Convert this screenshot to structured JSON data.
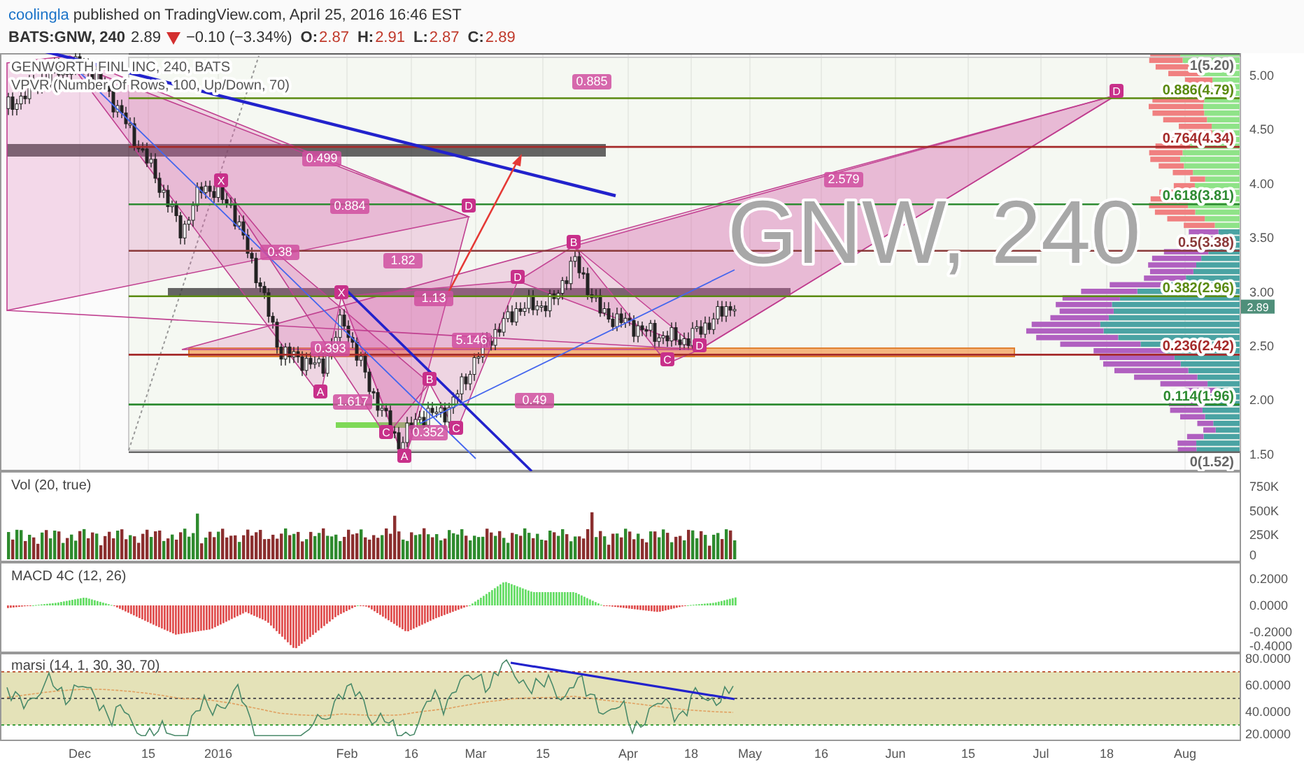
{
  "header": {
    "author": "coolingla",
    "published": "published on TradingView.com, April 25, 2016 16:46 EST"
  },
  "quote": {
    "symbol": "BATS:GNW, 240",
    "last": "2.89",
    "falling": true,
    "change": "−0.10 (−3.34%)",
    "ohlc": [
      {
        "label": "O:",
        "value": "2.87"
      },
      {
        "label": "H:",
        "value": "2.91"
      },
      {
        "label": "L:",
        "value": "2.87"
      },
      {
        "label": "C:",
        "value": "2.89"
      }
    ]
  },
  "main_pane": {
    "legend": [
      "GENWORTH FINL INC, 240, BATS",
      "VPVR (Number Of Rows, 100, Up/Down, 70)"
    ],
    "watermark": "GNW, 240",
    "ratio_labels": [
      "0.885",
      "0.499",
      "2.579",
      "0.884",
      "0.38",
      "1.82",
      "1.13",
      "5.146",
      "0.393",
      "1.617",
      "0.352",
      "0.49"
    ],
    "point_labels": [
      "D",
      "D",
      "B",
      "D",
      "X",
      "X",
      "A",
      "B",
      "C",
      "C",
      "A",
      "C",
      "D"
    ],
    "fib_levels": [
      {
        "label": "1(5.20)",
        "color": "#666666"
      },
      {
        "label": "0.886(4.79)",
        "color": "#5a8a10"
      },
      {
        "label": "0.764(4.34)",
        "color": "#a52a2a"
      },
      {
        "label": "0.618(3.81)",
        "color": "#2e8b32"
      },
      {
        "label": "0.5(3.38)",
        "color": "#8b3a3a"
      },
      {
        "label": "0.382(2.96)",
        "color": "#5a8a10"
      },
      {
        "label": "0.236(2.42)",
        "color": "#a52a2a"
      },
      {
        "label": "0.114(1.96)",
        "color": "#2e8b32"
      },
      {
        "label": "0(1.52)",
        "color": "#666666"
      }
    ],
    "price_ticks": [
      "5.00",
      "4.50",
      "4.00",
      "3.50",
      "3.00",
      "2.50",
      "2.00",
      "1.50"
    ],
    "last_price": "2.89"
  },
  "volume_pane": {
    "title": "Vol (20, true)",
    "ticks": [
      "750K",
      "500K",
      "250K",
      "0"
    ]
  },
  "macd_pane": {
    "title": "MACD 4C (12, 26)",
    "ticks": [
      "0.2000",
      "0.0000",
      "-0.2000",
      "-0.4000"
    ]
  },
  "rsi_pane": {
    "title": "marsi (14, 1, 30, 30, 70)",
    "ticks": [
      "80.0000",
      "60.0000",
      "40.0000",
      "20.0000"
    ]
  },
  "time_axis": [
    "Dec",
    "15",
    "2016",
    "Feb",
    "16",
    "Mar",
    "15",
    "Apr",
    "18",
    "May",
    "16",
    "Jun",
    "15",
    "Jul",
    "18",
    "Aug"
  ]
}
